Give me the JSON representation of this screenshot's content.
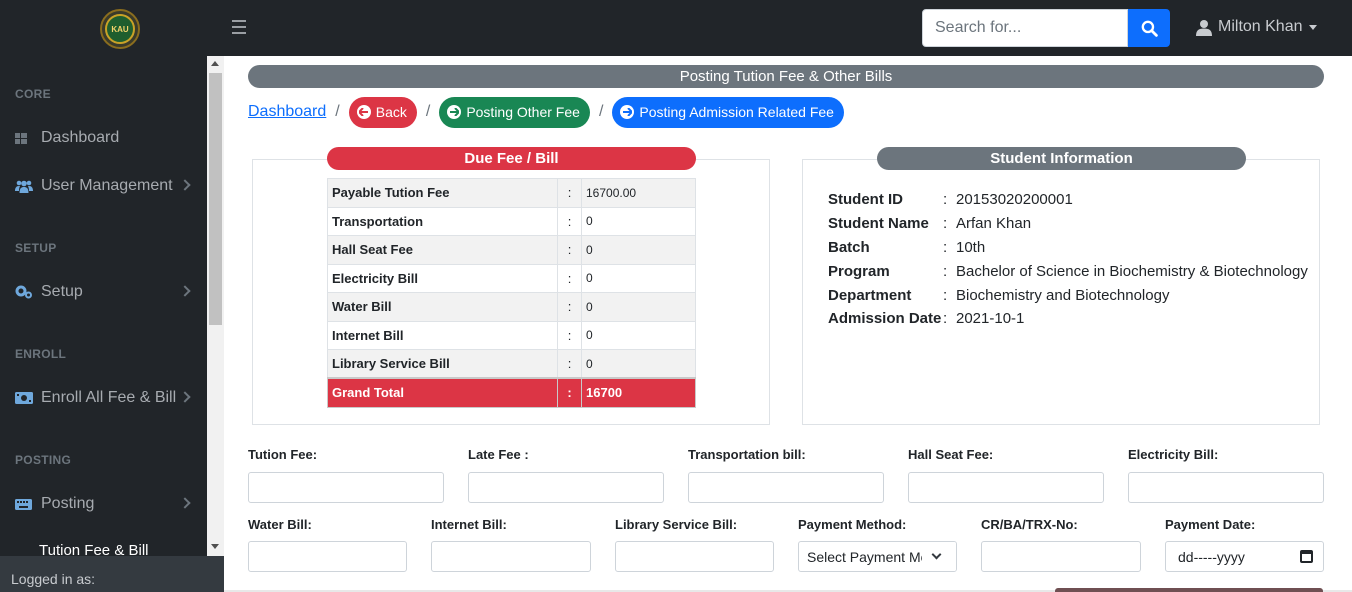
{
  "topbar": {
    "logo_text": "KAU",
    "search_placeholder": "Search for...",
    "user_name": "Milton Khan"
  },
  "sidebar": {
    "sections": [
      {
        "heading": "CORE",
        "items": [
          {
            "label": "Dashboard",
            "icon": "table-icon"
          },
          {
            "label": "User Management",
            "icon": "users-icon"
          }
        ]
      },
      {
        "heading": "SETUP",
        "items": [
          {
            "label": "Setup",
            "icon": "cogs-icon"
          }
        ]
      },
      {
        "heading": "ENROLL",
        "items": [
          {
            "label": "Enroll All Fee & Bill",
            "icon": "money-icon"
          }
        ]
      },
      {
        "heading": "POSTING",
        "items": [
          {
            "label": "Posting",
            "icon": "keyboard-icon"
          }
        ]
      }
    ],
    "headings": {
      "core": "CORE",
      "setup": "SETUP",
      "enroll": "ENROLL",
      "posting": "POSTING"
    },
    "items": {
      "dashboard": "Dashboard",
      "user_management": "User Management",
      "setup": "Setup",
      "enroll": "Enroll All Fee & Bill",
      "posting": "Posting"
    },
    "sub_item": "Tution Fee & Bill",
    "footer": "Logged in as:"
  },
  "page": {
    "title": "Posting Tution Fee & Other Bills"
  },
  "breadcrumb": {
    "dashboard": "Dashboard",
    "back": "Back",
    "posting_other_fee": "Posting Other Fee",
    "posting_admission_fee": "Posting Admission Related Fee"
  },
  "due_fee": {
    "title": "Due Fee / Bill",
    "rows": [
      {
        "label": "Payable Tution Fee",
        "value": "16700.00"
      },
      {
        "label": "Transportation",
        "value": "0"
      },
      {
        "label": "Hall Seat Fee",
        "value": "0"
      },
      {
        "label": "Electricity Bill",
        "value": "0"
      },
      {
        "label": "Water Bill",
        "value": "0"
      },
      {
        "label": "Internet Bill",
        "value": "0"
      },
      {
        "label": "Library Service Bill",
        "value": "0"
      }
    ],
    "separator": ":",
    "total_label": "Grand Total",
    "total_value": "16700"
  },
  "student": {
    "title": "Student Information",
    "fields": [
      {
        "key": "Student ID",
        "value": "20153020200001"
      },
      {
        "key": "Student Name",
        "value": "Arfan Khan"
      },
      {
        "key": "Batch",
        "value": "10th"
      },
      {
        "key": "Program",
        "value": "Bachelor of Science in Biochemistry & Biotechnology"
      },
      {
        "key": "Department",
        "value": "Biochemistry and Biotechnology"
      },
      {
        "key": "Admission Date",
        "value": "2021-10-1"
      }
    ]
  },
  "form": {
    "tution_fee": "Tution Fee:",
    "late_fee": "Late Fee :",
    "transportation_bill": "Transportation bill:",
    "hall_seat_fee": "Hall Seat Fee:",
    "electricity_bill": "Electricity Bill:",
    "water_bill": "Water Bill:",
    "internet_bill": "Internet Bill:",
    "library_service_bill": "Library Service Bill:",
    "payment_method": "Payment Method:",
    "payment_method_value": "Select Payment Method",
    "cr_ba_trx_no": "CR/BA/TRX-No:",
    "payment_date": "Payment Date:",
    "payment_date_value": "dd-----yyyy"
  },
  "colors": {
    "dark": "#212529",
    "primary": "#0d6efd",
    "danger": "#dc3545",
    "success": "#198754",
    "secondary": "#6c757d"
  }
}
